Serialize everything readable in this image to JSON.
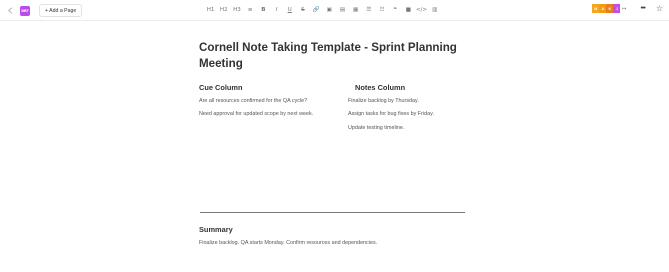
{
  "toolbar": {
    "badge_text": "DRF",
    "add_page_label": "+ Add a Page",
    "format_buttons": [
      {
        "name": "heading-1-button",
        "label": "H1"
      },
      {
        "name": "heading-2-button",
        "label": "H2"
      },
      {
        "name": "heading-3-button",
        "label": "H3"
      },
      {
        "name": "paragraph-button",
        "label": "≡"
      },
      {
        "name": "bold-button",
        "label": "B"
      },
      {
        "name": "italic-button",
        "label": "I"
      },
      {
        "name": "underline-button",
        "label": "U"
      },
      {
        "name": "strikethrough-button",
        "label": "S"
      },
      {
        "name": "link-button",
        "label": "🔗"
      },
      {
        "name": "image-button",
        "label": "▣"
      },
      {
        "name": "video-button",
        "label": "▤"
      },
      {
        "name": "table-button",
        "label": "▦"
      },
      {
        "name": "bullet-list-button",
        "label": "☰"
      },
      {
        "name": "numbered-list-button",
        "label": "☷"
      },
      {
        "name": "quote-button",
        "label": "❝"
      },
      {
        "name": "embed-button",
        "label": "■"
      },
      {
        "name": "code-button",
        "label": "</>"
      },
      {
        "name": "more-format-button",
        "label": "▥"
      }
    ],
    "collaborators": [
      {
        "initial": "M",
        "color": "#f6a623"
      },
      {
        "initial": "A",
        "color": "#f39c12"
      },
      {
        "initial": "K",
        "color": "#e67e22"
      },
      {
        "initial": "J",
        "color": "#c54de0"
      }
    ],
    "collab_arrow": "↦",
    "more_label": "•••",
    "star_label": "☆"
  },
  "document": {
    "title": "Cornell Note Taking Template - Sprint Planning Meeting",
    "cue_heading": "Cue Column",
    "cue_items": [
      "Are all resources confirmed for the QA cycle?",
      "Need approval for updated scope by next week."
    ],
    "notes_heading": "Notes Column",
    "notes_items": [
      "Finalize backlog by Thursday.",
      "Assign tasks for bug fixes by Friday.",
      "Update testing timeline."
    ],
    "summary_heading": "Summary",
    "summary_text": "Finalize backlog. QA starts Monday. Confirm resources and dependencies."
  },
  "colors": {
    "badge": "#b94de8",
    "divider": "#7a7a7a"
  }
}
